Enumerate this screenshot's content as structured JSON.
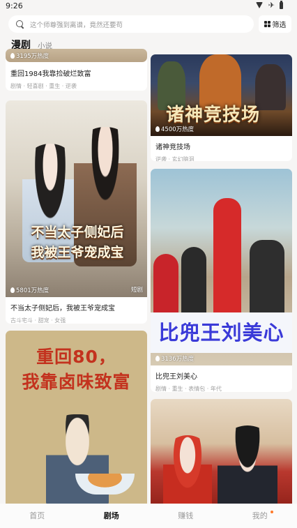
{
  "status_bar": {
    "time": "9:26"
  },
  "search": {
    "placeholder": "这个师尊强到离谱，竟然还要苟"
  },
  "filter": {
    "label": "筛选"
  },
  "tabs": [
    {
      "label": "漫剧",
      "active": true
    },
    {
      "label": "小说",
      "active": false
    }
  ],
  "left_column": [
    {
      "heat": "3195万热度",
      "title": "重回1984我靠捡破烂致富",
      "tags": "剧情 · 轻喜剧 · 重生 · 逆袭"
    },
    {
      "heat": "5801万热度",
      "badge": "短剧",
      "cover_text": [
        "不当太子侧妃后",
        "我被王爷宠成宝"
      ],
      "title": "不当太子侧妃后，我被王爷宠成宝",
      "tags": "古斗宅斗 · 甜宠 · 女强"
    },
    {
      "cover_text": [
        "重回80，",
        "我靠卤味致富"
      ]
    }
  ],
  "right_column": [
    {
      "heat": "4500万热度",
      "cover_text": "诸神竞技场",
      "title": "诸神竞技场",
      "tags": "逆袭 · 玄幻脑洞"
    },
    {
      "heat": "3136万热度",
      "cover_text": "比兜王刘美心",
      "title": "比兜王刘美心",
      "tags": "剧情 · 重生 · 表情包 · 年代"
    },
    {}
  ],
  "bottom_nav": [
    {
      "label": "首页",
      "active": false
    },
    {
      "label": "剧场",
      "active": true
    },
    {
      "label": "赚钱",
      "active": false
    },
    {
      "label": "我的",
      "active": false,
      "has_dot": true
    }
  ],
  "colors": {
    "accent_dot": "#ff7a2a",
    "meixin_text": "#3a3ad8",
    "eighty_text": "#c3321e"
  }
}
